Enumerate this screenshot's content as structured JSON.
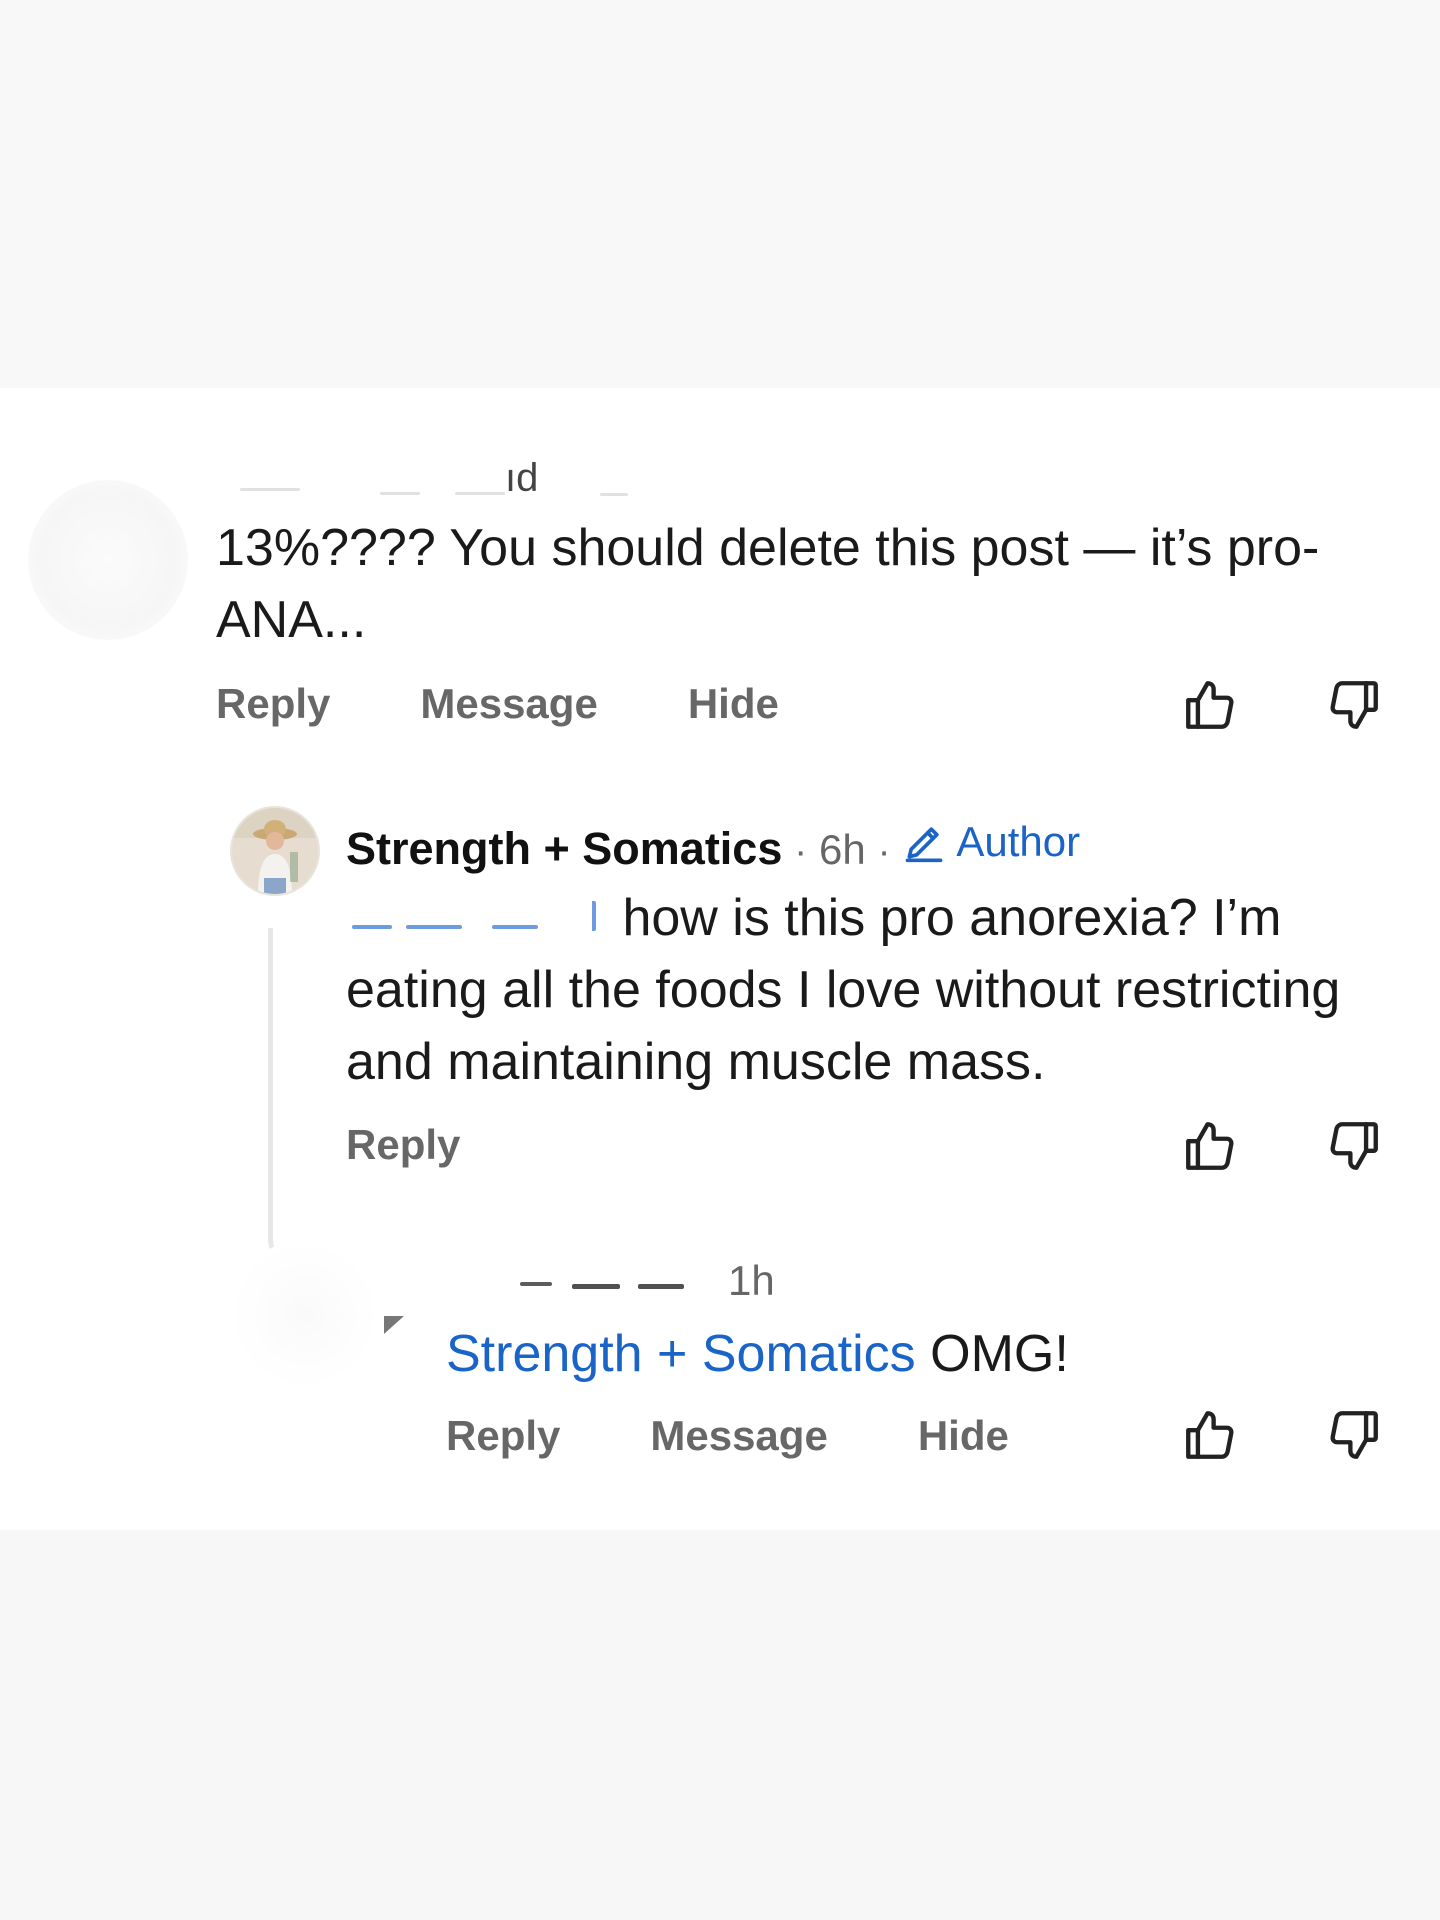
{
  "comment1": {
    "author_partial": "ıd",
    "text": "13%???? You should delete this post — it’s pro-ANA...",
    "actions": {
      "reply": "Reply",
      "message": "Message",
      "hide": "Hide"
    }
  },
  "comment2": {
    "author": "Strength + Somatics",
    "separator": "·",
    "time": "6h",
    "author_badge": "Author",
    "text": "how is this pro anorexia? I’m eating all the foods I love without restricting and maintaining muscle mass.",
    "actions": {
      "reply": "Reply"
    }
  },
  "comment3": {
    "time": "1h",
    "mention": "Strength + Somatics",
    "text": " OMG!",
    "actions": {
      "reply": "Reply",
      "message": "Message",
      "hide": "Hide"
    }
  },
  "colors": {
    "link": "#1a63c7",
    "action": "#676767",
    "thread_line": "#e7e7e7"
  },
  "icons": {
    "like": "thumbs-up-icon",
    "dislike": "thumbs-down-icon",
    "edit": "pencil-icon"
  }
}
